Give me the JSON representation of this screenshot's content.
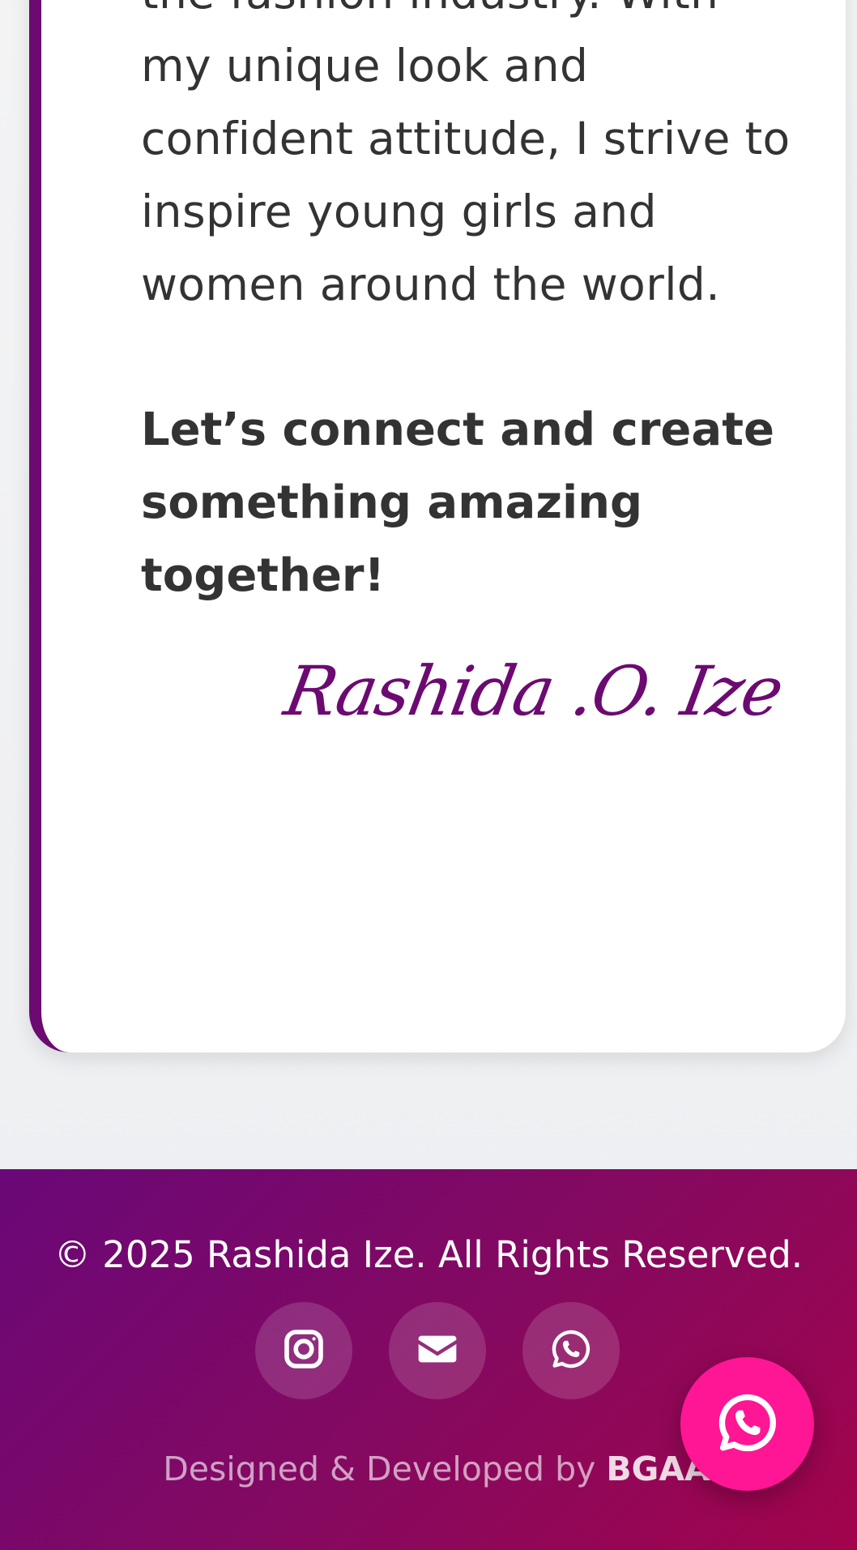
{
  "about": {
    "body_text": "mission to redefine beauty\nstandards and promote\nauthentic representation in\nthe fashion industry. With\nmy unique look and\nconfident attitude, I strive to\ninspire young girls and\nwomen around the world.",
    "cta_text": "Let’s connect and create\nsomething amazing\ntogether!",
    "signature": "Rashida .O. Ize"
  },
  "footer": {
    "copyright": "© 2025 Rashida Ize. All Rights Reserved.",
    "social": [
      {
        "name": "instagram",
        "icon": "instagram-icon"
      },
      {
        "name": "email",
        "icon": "envelope-icon"
      },
      {
        "name": "whatsapp",
        "icon": "whatsapp-icon"
      }
    ],
    "credit_prefix": "Designed & Developed by ",
    "credit_brand": "BGAA"
  },
  "floating_button": {
    "icon": "whatsapp-icon"
  },
  "colors": {
    "accent_purple": "#6c0a72",
    "footer_gradient_start": "#6a0878",
    "footer_gradient_end": "#a2044c",
    "whatsapp_fab": "#fe1694",
    "text": "#333333"
  }
}
